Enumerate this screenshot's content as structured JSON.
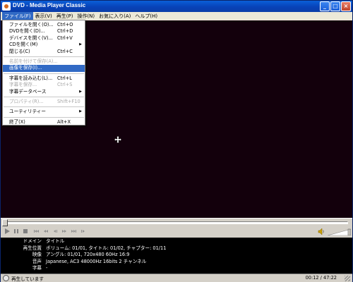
{
  "window": {
    "title": "DVD - Media Player Classic"
  },
  "menubar": {
    "items": [
      {
        "label": "ファイル(F)"
      },
      {
        "label": "表示(V)"
      },
      {
        "label": "再生(P)"
      },
      {
        "label": "操作(N)"
      },
      {
        "label": "お気に入り(A)"
      },
      {
        "label": "ヘルプ(H)"
      }
    ],
    "active": "ファイル(F)"
  },
  "file_menu": {
    "items": [
      {
        "label": "ファイルを開く(O)...",
        "shortcut": "Ctrl+O",
        "enabled": true
      },
      {
        "label": "DVDを開く(D)...",
        "shortcut": "Ctrl+D",
        "enabled": true
      },
      {
        "label": "デバイスを開く(V)...",
        "shortcut": "Ctrl+V",
        "enabled": true
      },
      {
        "label": "CDを開く(M)",
        "shortcut": "",
        "enabled": true,
        "submenu": true
      },
      {
        "label": "閉じる(C)",
        "shortcut": "Ctrl+C",
        "enabled": true
      },
      {
        "label": "名前を付けて保存(A)...",
        "shortcut": "",
        "enabled": false
      },
      {
        "label": "画像を保存(I)...",
        "shortcut": "",
        "enabled": true,
        "highlighted": true
      },
      {
        "label": "字幕を読み込む(L)...",
        "shortcut": "Ctrl+L",
        "enabled": true
      },
      {
        "label": "字幕を保存...",
        "shortcut": "Ctrl+S",
        "enabled": false
      },
      {
        "label": "字幕データベース",
        "shortcut": "",
        "enabled": true,
        "submenu": true
      },
      {
        "label": "プロパティ(R)...",
        "shortcut": "Shift+F10",
        "enabled": false
      },
      {
        "label": "ユーティリティー",
        "shortcut": "",
        "enabled": true,
        "submenu": true
      },
      {
        "label": "終了(X)",
        "shortcut": "Alt+X",
        "enabled": true
      }
    ],
    "submenu_arrow": "▶"
  },
  "playback": {
    "seek_position_fraction": 0.0
  },
  "controls": {
    "buttons": [
      "play-icon",
      "pause-icon",
      "stop-icon",
      "skip-back-icon",
      "rewind-icon",
      "frame-back-icon",
      "fast-forward-icon",
      "skip-forward-icon",
      "frame-step-icon"
    ],
    "volume_icon": "speaker-icon"
  },
  "info_panel": {
    "rows": [
      {
        "key": "ドメイン",
        "value": "タイトル"
      },
      {
        "key": "再生位置",
        "value": "ボリューム: 01/01, タイトル: 01/02, チャプター: 01/11"
      },
      {
        "key": "映像",
        "value": "アングル: 01/01, 720x480 60Hz 16:9"
      },
      {
        "key": "音声",
        "value": "Japanese, AC3 48000Hz 16bits 2 チャンネル"
      },
      {
        "key": "字幕",
        "value": "-"
      }
    ]
  },
  "statusbar": {
    "text": "再生しています",
    "time": "00:12 / 47:22"
  },
  "colors": {
    "video_background": "#13000c",
    "menu_highlight": "#316ac5",
    "titlebar": "#0a5fd8"
  }
}
